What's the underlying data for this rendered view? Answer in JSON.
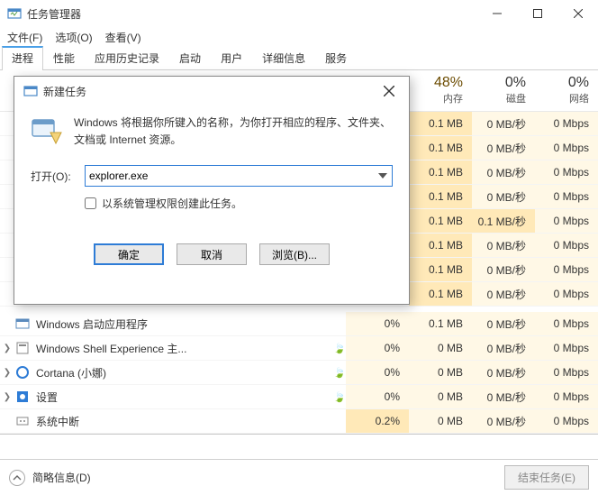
{
  "window": {
    "title": "任务管理器",
    "menus": [
      "文件(F)",
      "选项(O)",
      "查看(V)"
    ]
  },
  "tabs": [
    "进程",
    "性能",
    "应用历史记录",
    "启动",
    "用户",
    "详细信息",
    "服务"
  ],
  "activeTab": 0,
  "columns": {
    "cpu": {
      "pct": "48%",
      "label": "内存"
    },
    "mem": {
      "pct": "0%",
      "label": "磁盘"
    },
    "disk": {
      "pct": "0%",
      "label": "网络"
    }
  },
  "rowsTop": [
    {
      "cpu": "",
      "mem": "0.1 MB",
      "disk": "0 MB/秒",
      "net": "0 Mbps"
    },
    {
      "cpu": "",
      "mem": "0.1 MB",
      "disk": "0 MB/秒",
      "net": "0 Mbps"
    },
    {
      "cpu": "",
      "mem": "0.1 MB",
      "disk": "0 MB/秒",
      "net": "0 Mbps"
    },
    {
      "cpu": "",
      "mem": "0.1 MB",
      "disk": "0 MB/秒",
      "net": "0 Mbps"
    },
    {
      "cpu": "",
      "mem": "0.1 MB",
      "disk": "0.1 MB/秒",
      "net": "0 Mbps",
      "diskHot": true
    },
    {
      "cpu": "",
      "mem": "0.1 MB",
      "disk": "0 MB/秒",
      "net": "0 Mbps"
    },
    {
      "cpu": "",
      "mem": "0.1 MB",
      "disk": "0 MB/秒",
      "net": "0 Mbps"
    },
    {
      "cpu": "",
      "mem": "0.1 MB",
      "disk": "0 MB/秒",
      "net": "0 Mbps"
    }
  ],
  "rowsBottom": [
    {
      "name": "Windows 启动应用程序",
      "icon": "startup",
      "expand": false,
      "leaf": false,
      "cpu": "0%",
      "mem": "0.1 MB",
      "disk": "0 MB/秒",
      "net": "0 Mbps"
    },
    {
      "name": "Windows Shell Experience 主...",
      "icon": "shell",
      "expand": true,
      "leaf": true,
      "cpu": "0%",
      "mem": "0 MB",
      "disk": "0 MB/秒",
      "net": "0 Mbps"
    },
    {
      "name": "Cortana (小娜)",
      "icon": "cortana",
      "expand": true,
      "leaf": true,
      "cpu": "0%",
      "mem": "0 MB",
      "disk": "0 MB/秒",
      "net": "0 Mbps"
    },
    {
      "name": "设置",
      "icon": "settings",
      "expand": true,
      "leaf": true,
      "cpu": "0%",
      "mem": "0 MB",
      "disk": "0 MB/秒",
      "net": "0 Mbps"
    },
    {
      "name": "系统中断",
      "icon": "system",
      "expand": false,
      "leaf": false,
      "cpu": "0.2%",
      "cpuHot": true,
      "mem": "0 MB",
      "disk": "0 MB/秒",
      "net": "0 Mbps"
    }
  ],
  "footer": {
    "brief": "简略信息(D)",
    "endTask": "结束任务(E)"
  },
  "dialog": {
    "title": "新建任务",
    "message": "Windows 将根据你所键入的名称，为你打开相应的程序、文件夹、文档或 Internet 资源。",
    "openLabel": "打开(O):",
    "inputValue": "explorer.exe",
    "adminCheck": "以系统管理权限创建此任务。",
    "ok": "确定",
    "cancel": "取消",
    "browse": "浏览(B)..."
  }
}
